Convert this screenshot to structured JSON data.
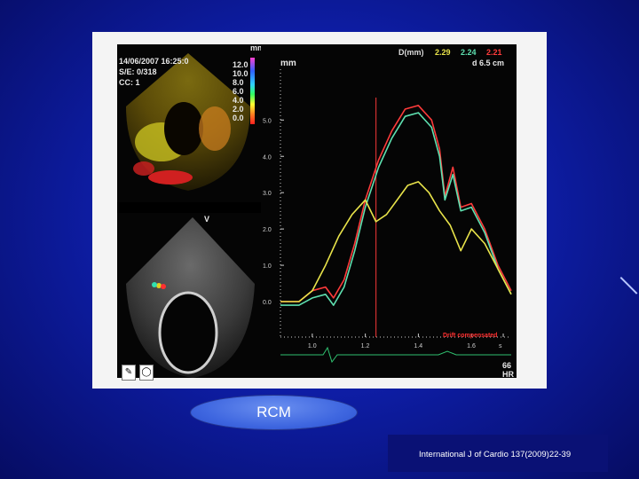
{
  "caption": "RCM",
  "citation": "International J of Cardio 137(2009)22-39",
  "echo": {
    "date_time": "14/06/2007 16:25:0",
    "s_e": "S/E: 0/318",
    "cc": "CC: 1",
    "scale_unit": "mm",
    "scale_ticks": [
      "12.0",
      "10.0",
      "8.0",
      "6.0",
      "4.0",
      "2.0",
      "0.0"
    ],
    "d_label": "D(mm)",
    "d_values": [
      "2.29",
      "2.24",
      "2.21"
    ],
    "d_colors": [
      "#e8e34a",
      "#5ee0b0",
      "#ff3b3b"
    ],
    "depth": "d 6.5 cm",
    "plot_unit": "mm",
    "y_ticks": [
      "6.0",
      "5.0",
      "4.0",
      "3.0",
      "2.0",
      "1.0",
      "0.0"
    ],
    "x_ticks": [
      "1.0",
      "1.2",
      "1.4",
      "1.6",
      "s"
    ],
    "hr_value": "66",
    "hr_label": "HR",
    "annotation": "Drift compensated",
    "v_marker": "V"
  },
  "chart_data": {
    "type": "line",
    "xlabel": "s",
    "ylabel": "mm",
    "ylim": [
      0,
      6
    ],
    "xlim": [
      0.88,
      1.75
    ],
    "series": [
      {
        "color": "#ff3b3b",
        "x": [
          0.88,
          0.95,
          1.0,
          1.05,
          1.08,
          1.12,
          1.16,
          1.2,
          1.25,
          1.3,
          1.35,
          1.4,
          1.45,
          1.48,
          1.5,
          1.53,
          1.56,
          1.6,
          1.65,
          1.7,
          1.75
        ],
        "y": [
          0.0,
          0.0,
          0.3,
          0.4,
          0.1,
          0.6,
          1.6,
          2.8,
          3.9,
          4.7,
          5.3,
          5.4,
          5.0,
          4.2,
          2.9,
          3.7,
          2.6,
          2.7,
          2.0,
          1.0,
          0.3
        ]
      },
      {
        "color": "#5ee0b0",
        "x": [
          0.88,
          0.95,
          1.0,
          1.05,
          1.08,
          1.12,
          1.16,
          1.2,
          1.25,
          1.3,
          1.35,
          1.4,
          1.45,
          1.48,
          1.5,
          1.53,
          1.56,
          1.6,
          1.65,
          1.7,
          1.75
        ],
        "y": [
          -0.1,
          -0.1,
          0.1,
          0.2,
          -0.1,
          0.4,
          1.4,
          2.6,
          3.7,
          4.5,
          5.1,
          5.2,
          4.8,
          4.0,
          2.8,
          3.5,
          2.5,
          2.6,
          1.9,
          0.9,
          0.2
        ]
      },
      {
        "color": "#e8e34a",
        "x": [
          0.88,
          0.95,
          1.0,
          1.05,
          1.1,
          1.15,
          1.2,
          1.24,
          1.28,
          1.32,
          1.36,
          1.4,
          1.44,
          1.48,
          1.52,
          1.56,
          1.6,
          1.65,
          1.7,
          1.75
        ],
        "y": [
          0.0,
          0.0,
          0.3,
          1.0,
          1.8,
          2.4,
          2.8,
          2.2,
          2.4,
          2.8,
          3.2,
          3.3,
          3.0,
          2.5,
          2.1,
          1.4,
          2.0,
          1.6,
          0.9,
          0.2
        ]
      }
    ]
  }
}
